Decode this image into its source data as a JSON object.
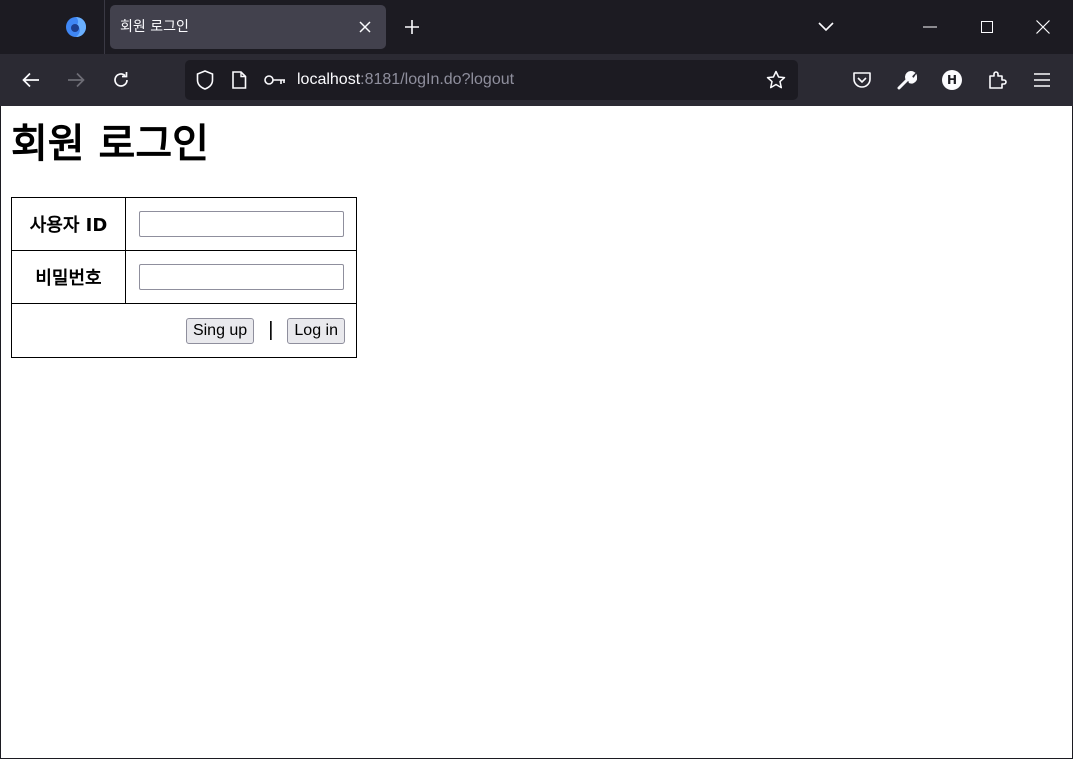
{
  "browser": {
    "tab_title": "회원 로그인",
    "url_host": "localhost",
    "url_rest": ":8181/logIn.do?logout",
    "profile_initial": "H",
    "colors": {
      "tabstrip": "#1c1b22",
      "navbar": "#2b2a33",
      "active_tab": "#42414d",
      "urlbar": "#1c1b22",
      "text": "#fbfbfe",
      "dim_text": "#8f8f9d"
    }
  },
  "page": {
    "heading": "회원 로그인",
    "form": {
      "user_id_label": "사용자 ID",
      "user_id_value": "",
      "password_label": "비밀번호",
      "password_value": "",
      "signup_label": "Sing up",
      "separator": "|",
      "login_label": "Log in"
    }
  }
}
